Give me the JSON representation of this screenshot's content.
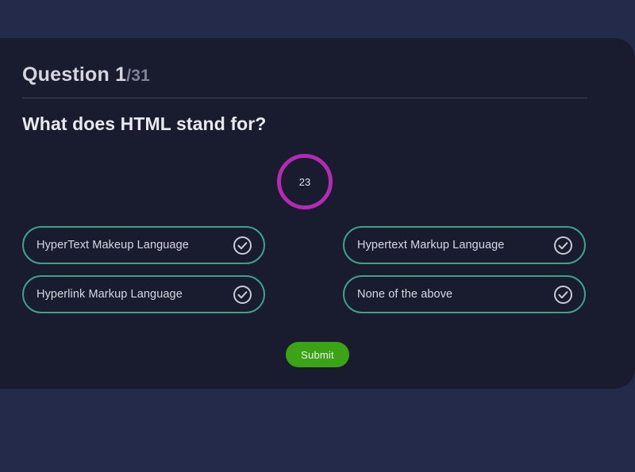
{
  "page": {
    "background_color": "#242b4a",
    "card_background_color": "#181c2e"
  },
  "header": {
    "counter_label": "Question",
    "counter_current": "1",
    "counter_total": "/31",
    "question": "What does HTML stand for?"
  },
  "timer": {
    "value": "23",
    "ring_color": "#b32bb3",
    "icon": "countdown-timer-ring"
  },
  "options": [
    {
      "label": "HyperText Makeup Language",
      "icon": "check-circle-icon",
      "border_color": "#3fa08c"
    },
    {
      "label": "Hypertext Markup Language",
      "icon": "check-circle-icon",
      "border_color": "#3fa08c"
    },
    {
      "label": "Hyperlink Markup Language",
      "icon": "check-circle-icon",
      "border_color": "#3fa08c"
    },
    {
      "label": "None of the above",
      "icon": "check-circle-icon",
      "border_color": "#3fa08c"
    }
  ],
  "actions": {
    "submit_label": "Submit",
    "submit_color": "#3aa316"
  }
}
